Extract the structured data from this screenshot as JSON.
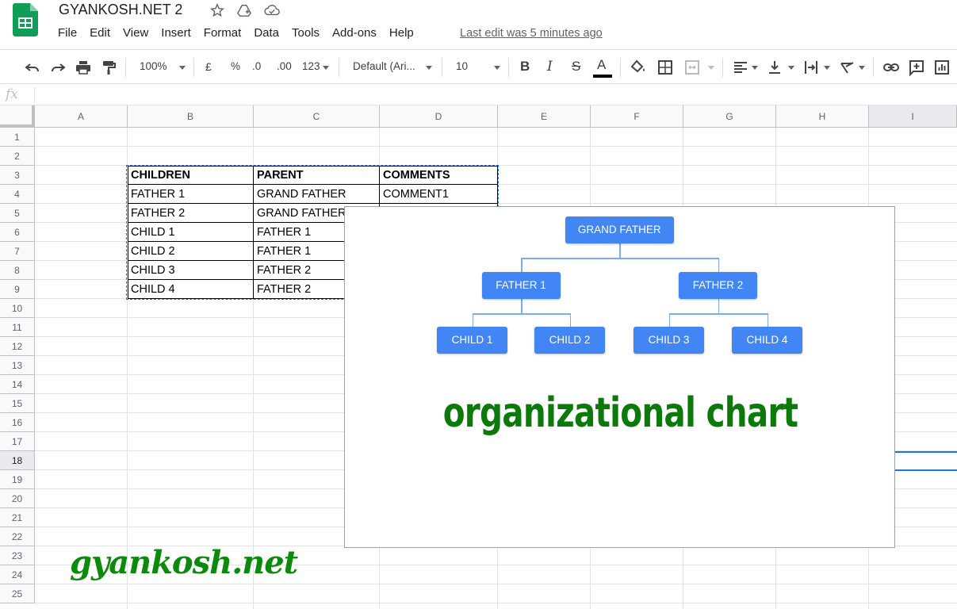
{
  "app": {
    "doc_title": "GYANKOSH.NET 2",
    "last_edit": "Last edit was 5 minutes ago",
    "menu": [
      "File",
      "Edit",
      "View",
      "Insert",
      "Format",
      "Data",
      "Tools",
      "Add-ons",
      "Help"
    ]
  },
  "toolbar": {
    "zoom": "100%",
    "currency": "£",
    "percent": "%",
    "decrease_decimal": ".0",
    "increase_decimal": ".00",
    "more_formats": "123",
    "font_family": "Default (Ari...",
    "font_size": "10",
    "bold": "B",
    "italic": "I",
    "strike": "S",
    "text_color": "A",
    "icons": [
      "undo-icon",
      "redo-icon",
      "print-icon",
      "paint-format-icon",
      "fill-color-icon",
      "borders-icon",
      "merge-icon",
      "align-icon",
      "valign-icon",
      "wrap-icon",
      "rotate-icon",
      "link-icon",
      "comment-icon",
      "chart-icon"
    ]
  },
  "formula_bar": {
    "fx": "fx",
    "value": ""
  },
  "grid": {
    "columns": [
      "A",
      "B",
      "C",
      "D",
      "E",
      "F",
      "G",
      "H",
      "I"
    ],
    "rows": [
      "1",
      "2",
      "3",
      "4",
      "5",
      "6",
      "7",
      "8",
      "9",
      "10",
      "11",
      "12",
      "13",
      "14",
      "15",
      "16",
      "17",
      "18",
      "19",
      "20",
      "21",
      "22",
      "23",
      "24",
      "25"
    ],
    "selected_row": "18",
    "selected_column": "I"
  },
  "table": {
    "headers": [
      "CHILDREN",
      "PARENT",
      "COMMENTS"
    ],
    "rows": [
      [
        "FATHER 1",
        "GRAND FATHER",
        "COMMENT1"
      ],
      [
        "FATHER 2",
        "GRAND FATHER",
        ""
      ],
      [
        "CHILD 1",
        "FATHER 1",
        ""
      ],
      [
        "CHILD 2",
        "FATHER 1",
        ""
      ],
      [
        "CHILD 3",
        "FATHER 2",
        ""
      ],
      [
        "CHILD 4",
        "FATHER 2",
        ""
      ]
    ]
  },
  "chart_data": {
    "type": "org-chart",
    "nodes": [
      {
        "name": "GRAND FATHER",
        "parent": ""
      },
      {
        "name": "FATHER 1",
        "parent": "GRAND FATHER"
      },
      {
        "name": "FATHER 2",
        "parent": "GRAND FATHER"
      },
      {
        "name": "CHILD 1",
        "parent": "FATHER 1"
      },
      {
        "name": "CHILD 2",
        "parent": "FATHER 1"
      },
      {
        "name": "CHILD 3",
        "parent": "FATHER 2"
      },
      {
        "name": "CHILD 4",
        "parent": "FATHER 2"
      }
    ],
    "node_color": "#4285f4",
    "caption": "organizational chart",
    "caption_color": "#0b7a0b"
  },
  "watermark": "gyankosh.net"
}
